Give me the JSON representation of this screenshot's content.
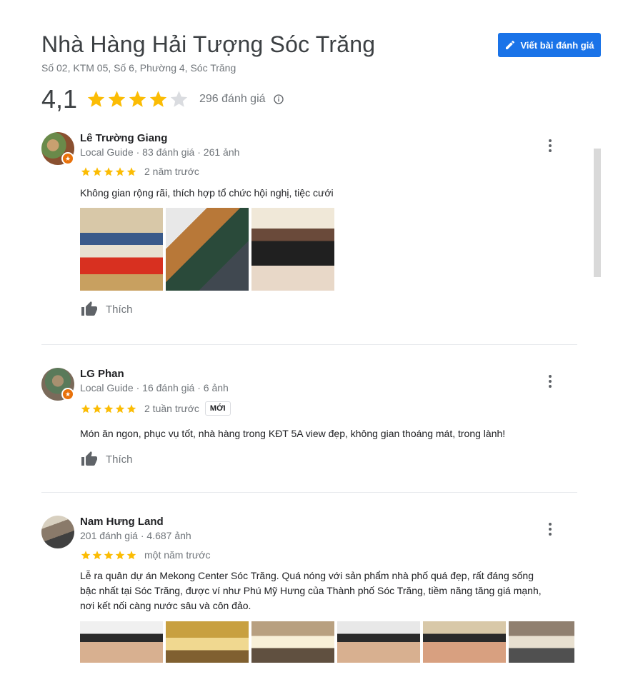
{
  "place": {
    "title": "Nhà Hàng Hải Tượng Sóc Trăng",
    "address": "Số 02, KTM 05, Số 6, Phường 4, Sóc Trăng",
    "rating": "4,1",
    "rating_value": 4.1,
    "review_count": "296 đánh giá"
  },
  "actions": {
    "write_review": "Viết bài đánh giá"
  },
  "colors": {
    "star": "#fbbc04",
    "star_empty": "#dadce0",
    "primary": "#1a73e8",
    "guide_badge": "#e8710a"
  },
  "reviews": [
    {
      "name": "Lê Trường Giang",
      "meta": "Local Guide · 83 đánh giá · 261 ảnh",
      "stars": 5,
      "time": "2 năm trước",
      "text": "Không gian rộng rãi, thích hợp tổ chức hội nghị, tiệc cưới",
      "like": "Thích"
    },
    {
      "name": "LG Phan",
      "meta": "Local Guide · 16 đánh giá · 6 ảnh",
      "stars": 5,
      "time": "2 tuần trước",
      "badge": "MỚI",
      "text": "Món ăn ngon, phục vụ tốt, nhà hàng trong KĐT 5A view đẹp, không gian thoáng mát,  trong lành!",
      "like": "Thích"
    },
    {
      "name": "Nam Hưng Land",
      "meta": "201 đánh giá · 4.687 ảnh",
      "stars": 5,
      "time": "một năm trước",
      "text_lines": [
        "Lễ ra quân dự án Mekong Center Sóc Trăng. Quá nóng với sản phẩm nhà phố quá đẹp, rất đáng sống",
        "bậc nhất tại Sóc Trăng, được ví như Phú Mỹ Hưng của Thành phố Sóc Trăng, tiềm năng tăng giá mạnh,",
        "nơi kết nối càng nước sâu và côn đảo."
      ]
    }
  ]
}
